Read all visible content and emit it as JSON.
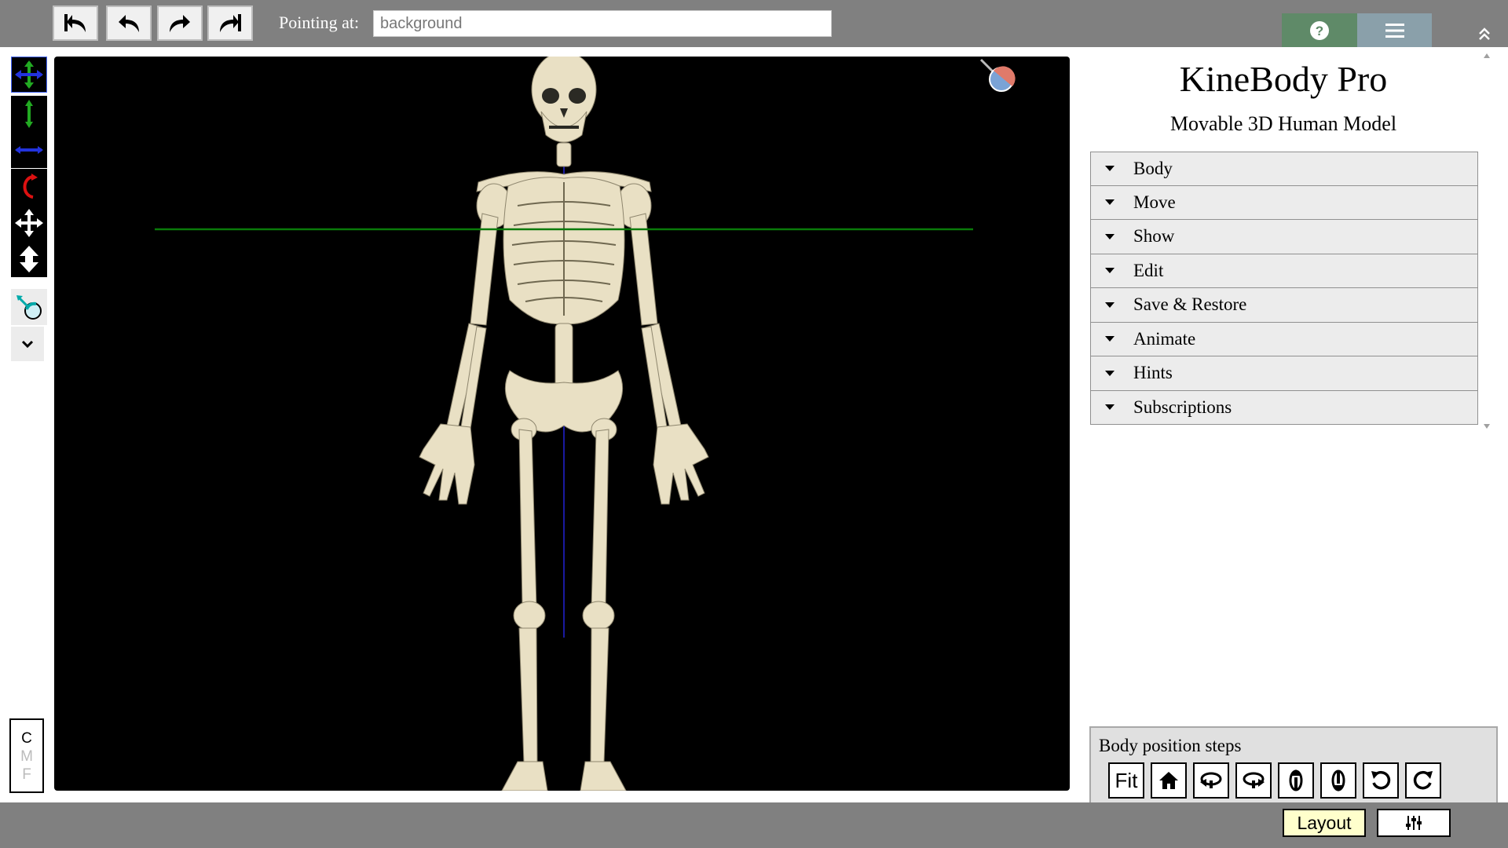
{
  "toolbar": {
    "history": [
      {
        "name": "undo-all-icon"
      },
      {
        "name": "undo-icon"
      },
      {
        "name": "redo-icon"
      },
      {
        "name": "redo-all-icon"
      }
    ],
    "pointing_label": "Pointing at:",
    "pointing_value": "background",
    "help_icon": "question-circle-icon",
    "menu_icon": "hamburger-menu-icon",
    "collapse_icon": "double-chevron-up-icon"
  },
  "left_tools": [
    {
      "name": "move-xy-icon",
      "color": "#22aa22"
    },
    {
      "name": "move-vertical-icon",
      "color": "#22aa22"
    },
    {
      "name": "move-horizontal-icon",
      "color": "#2233dd"
    },
    {
      "name": "rotate-icon",
      "color": "#dd1111"
    },
    {
      "name": "move-all-icon",
      "color": "#ffffff"
    },
    {
      "name": "move-depth-icon",
      "color": "#ffffff"
    },
    {
      "name": "pointer-tool-icon",
      "color": "#00aaaa"
    },
    {
      "name": "chevron-down-icon",
      "color": "#000000"
    }
  ],
  "cmf": {
    "c": "C",
    "m": "M",
    "f": "F"
  },
  "viewport": {
    "content": "skeleton-model",
    "axis_colors": {
      "horizontal": "#0a7a0a",
      "vertical": "#1a1aa0"
    },
    "bone_color": "#e9e0c4"
  },
  "panel": {
    "title": "KineBody Pro",
    "subtitle": "Movable 3D Human Model",
    "sections": [
      "Body",
      "Move",
      "Show",
      "Edit",
      "Save & Restore",
      "Animate",
      "Hints",
      "Subscriptions"
    ]
  },
  "steps": {
    "label": "Body position steps",
    "fit_label": "Fit",
    "buttons": [
      "home-icon",
      "turn-left-icon",
      "turn-right-icon",
      "tilt-forward-icon",
      "tilt-back-icon",
      "rotate-ccw-icon",
      "rotate-cw-icon"
    ]
  },
  "bottom": {
    "layout_label": "Layout",
    "settings_icon": "sliders-icon"
  },
  "colors": {
    "topbar": "#808080",
    "help_bg": "#5f8a68",
    "menu_bg": "#8aa0aa",
    "layout_bg": "#ffffcc"
  }
}
